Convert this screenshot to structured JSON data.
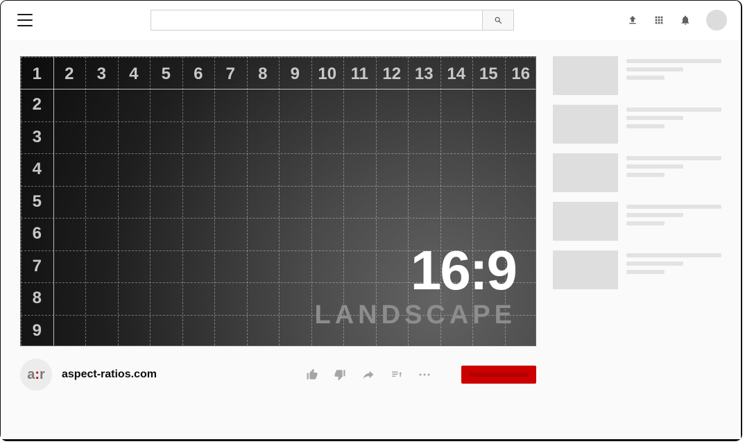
{
  "topbar": {
    "search_placeholder": ""
  },
  "player": {
    "columns": [
      "1",
      "2",
      "3",
      "4",
      "5",
      "6",
      "7",
      "8",
      "9",
      "10",
      "11",
      "12",
      "13",
      "14",
      "15",
      "16"
    ],
    "rows": [
      "1",
      "2",
      "3",
      "4",
      "5",
      "6",
      "7",
      "8",
      "9"
    ],
    "ratio_label": "16:9",
    "orientation_label": "LANDSCAPE"
  },
  "channel": {
    "avatar_text_a": "a",
    "avatar_text_colon": ":",
    "avatar_text_r": "r",
    "name": "aspect-ratios.com"
  },
  "sidebar": {
    "items": [
      {
        "lines": [
          "w1",
          "w2",
          "w3"
        ]
      },
      {
        "lines": [
          "w1",
          "w2",
          "w3"
        ]
      },
      {
        "lines": [
          "w1",
          "w2",
          "w3"
        ]
      },
      {
        "lines": [
          "w1",
          "w2",
          "w3"
        ]
      },
      {
        "lines": [
          "w1",
          "w2",
          "w3"
        ]
      }
    ]
  }
}
